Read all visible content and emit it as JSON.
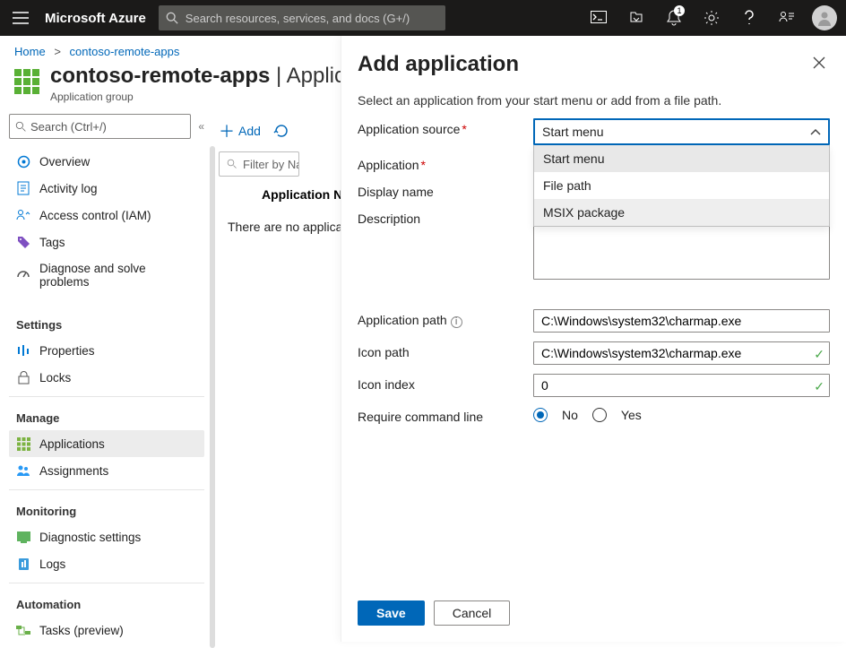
{
  "topbar": {
    "brand": "Microsoft Azure",
    "search_placeholder": "Search resources, services, and docs (G+/)",
    "notification_count": "1"
  },
  "breadcrumb": {
    "home": "Home",
    "item": "contoso-remote-apps"
  },
  "page": {
    "title_main": "contoso-remote-apps",
    "title_section": "Applications",
    "title_sep": " | ",
    "subtitle": "Application group"
  },
  "sidebar": {
    "search_placeholder": "Search (Ctrl+/)",
    "items": {
      "overview": "Overview",
      "activity": "Activity log",
      "iam": "Access control (IAM)",
      "tags": "Tags",
      "diag": "Diagnose and solve problems"
    },
    "sections": {
      "settings": "Settings",
      "manage": "Manage",
      "monitoring": "Monitoring",
      "automation": "Automation"
    },
    "settings": {
      "properties": "Properties",
      "locks": "Locks"
    },
    "manage": {
      "applications": "Applications",
      "assignments": "Assignments"
    },
    "monitoring": {
      "diag_settings": "Diagnostic settings",
      "logs": "Logs"
    },
    "automation": {
      "tasks": "Tasks (preview)"
    }
  },
  "toolbar": {
    "add": "Add"
  },
  "grid": {
    "filter": "Filter by Name",
    "col1": "Application Name",
    "empty": "There are no applications to show."
  },
  "flyout": {
    "title": "Add application",
    "intro": "Select an application from your start menu or add from a file path.",
    "labels": {
      "source": "Application source",
      "application": "Application",
      "display_name": "Display name",
      "description": "Description",
      "app_path": "Application path",
      "icon_path": "Icon path",
      "icon_index": "Icon index",
      "require_cmd": "Require command line"
    },
    "source": {
      "value": "Start menu",
      "options": [
        "Start menu",
        "File path",
        "MSIX package"
      ]
    },
    "values": {
      "app_path": "C:\\Windows\\system32\\charmap.exe",
      "icon_path": "C:\\Windows\\system32\\charmap.exe",
      "icon_index": "0"
    },
    "radio": {
      "no": "No",
      "yes": "Yes"
    },
    "buttons": {
      "save": "Save",
      "cancel": "Cancel"
    }
  }
}
